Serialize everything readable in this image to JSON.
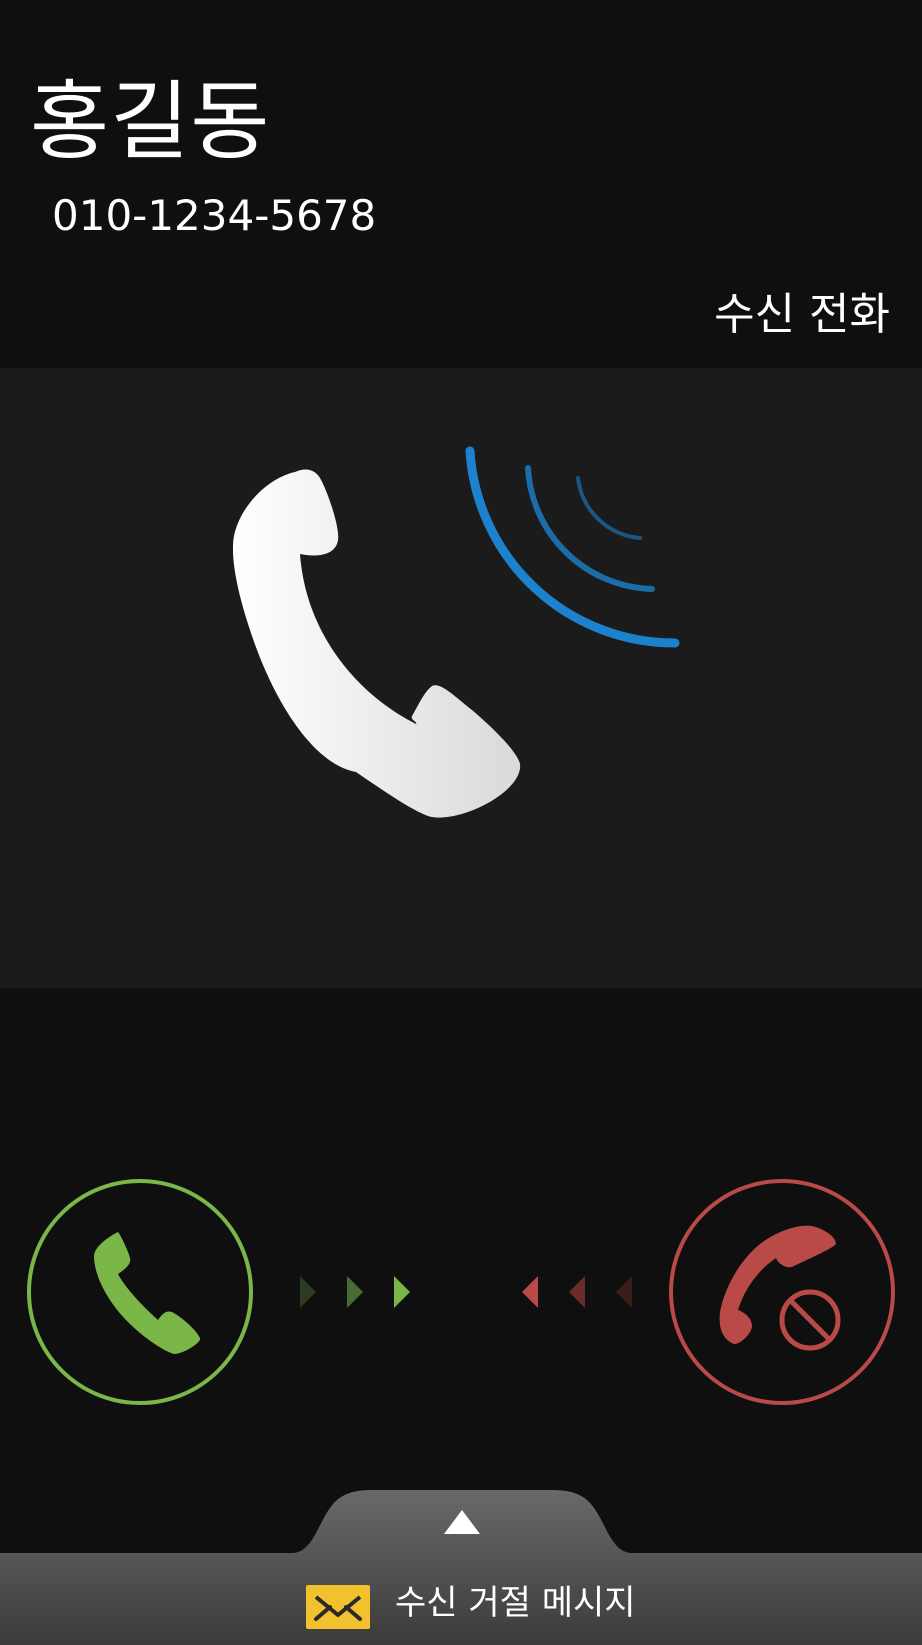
{
  "caller": {
    "name": "홍길동",
    "number": "010-1234-5678"
  },
  "call": {
    "status_label": "수신 전화"
  },
  "actions": {
    "accept_icon": "phone-accept-icon",
    "decline_icon": "phone-decline-icon",
    "accept_color": "#7ab648",
    "decline_color": "#b94a48"
  },
  "reject_message": {
    "label": "수신 거절 메시지",
    "icon": "envelope-icon",
    "icon_color": "#f2c12e"
  },
  "colors": {
    "background": "#0f0f0f",
    "middle_panel": "#1b1b1b",
    "signal_blue": "#1e88d8",
    "handset": "#f2f2f2"
  }
}
